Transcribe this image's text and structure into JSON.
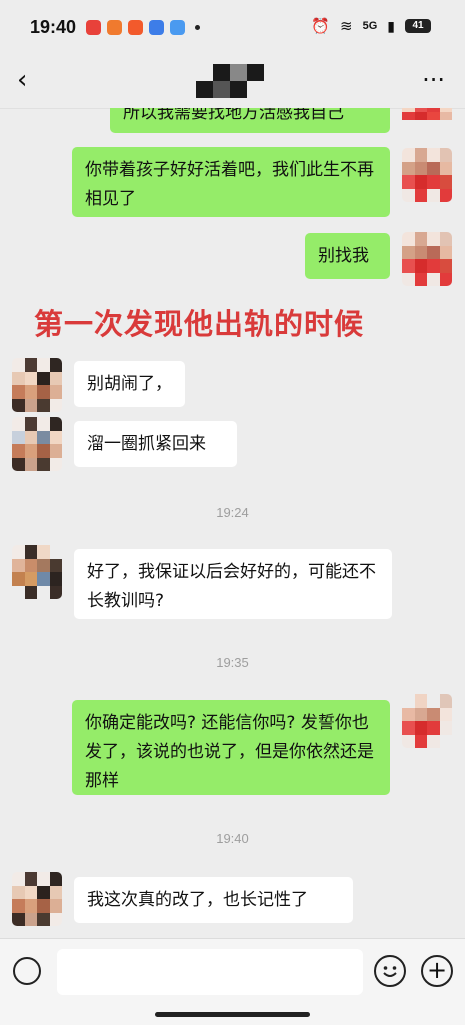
{
  "status_bar": {
    "time": "19:40",
    "network": "5G",
    "battery": "41"
  },
  "nav": {
    "back_icon": "chevron-left-icon",
    "more_icon": "ellipsis-icon"
  },
  "overlay_text": "第一次发现他出轨的时候",
  "messages": [
    {
      "side": "me",
      "text": "所以我需要找地方活感我自己"
    },
    {
      "side": "me",
      "text": "你带着孩子好好活着吧，我们此生不再相见了"
    },
    {
      "side": "me",
      "text": "别找我"
    },
    {
      "side": "other",
      "text": "别胡闹了，"
    },
    {
      "side": "other",
      "text": "溜一圈抓紧回来"
    },
    {
      "side": "other",
      "text": "好了，我保证以后会好好的，可能还不长教训吗?"
    },
    {
      "side": "me",
      "text": "你确定能改吗? 还能信你吗? 发誓你也发了，该说的也说了，但是你依然还是那样"
    },
    {
      "side": "other",
      "text": "我这次真的改了，也长记性了"
    }
  ],
  "timestamps": [
    "19:24",
    "19:35",
    "19:40"
  ],
  "colors": {
    "bubble_me": "#95ec69",
    "bubble_other": "#ffffff",
    "overlay": "#d93a3a",
    "background": "#ededed"
  }
}
